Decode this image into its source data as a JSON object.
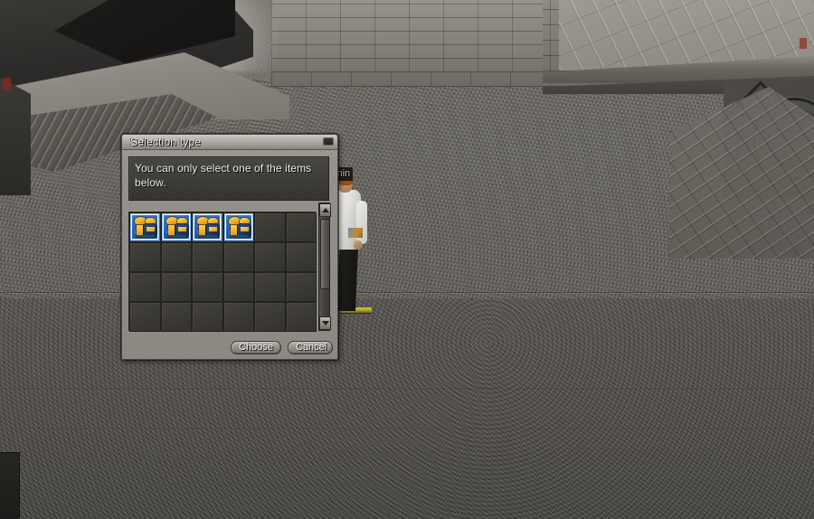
{
  "scene": {
    "character": {
      "name_label": "Admin",
      "description": "player-avatar-white-shirt"
    },
    "environment": "stone-courtyard"
  },
  "dialog": {
    "title": "Selection type",
    "close_icon": "close-icon",
    "message": "You can only select one of the items below.",
    "scrollbar": {
      "up_icon": "arrow-up-icon",
      "down_icon": "arrow-down-icon"
    },
    "grid": {
      "columns": 6,
      "rows": 4,
      "cells": [
        {
          "filled": true,
          "selected": true,
          "icon": "blue-gold-item-icon"
        },
        {
          "filled": true,
          "selected": true,
          "icon": "blue-gold-item-icon"
        },
        {
          "filled": true,
          "selected": true,
          "icon": "blue-gold-item-icon"
        },
        {
          "filled": true,
          "selected": true,
          "icon": "blue-gold-item-icon"
        },
        {
          "filled": false,
          "selected": false,
          "icon": ""
        },
        {
          "filled": false,
          "selected": false,
          "icon": ""
        },
        {
          "filled": false,
          "selected": false,
          "icon": ""
        },
        {
          "filled": false,
          "selected": false,
          "icon": ""
        },
        {
          "filled": false,
          "selected": false,
          "icon": ""
        },
        {
          "filled": false,
          "selected": false,
          "icon": ""
        },
        {
          "filled": false,
          "selected": false,
          "icon": ""
        },
        {
          "filled": false,
          "selected": false,
          "icon": ""
        },
        {
          "filled": false,
          "selected": false,
          "icon": ""
        },
        {
          "filled": false,
          "selected": false,
          "icon": ""
        },
        {
          "filled": false,
          "selected": false,
          "icon": ""
        },
        {
          "filled": false,
          "selected": false,
          "icon": ""
        },
        {
          "filled": false,
          "selected": false,
          "icon": ""
        },
        {
          "filled": false,
          "selected": false,
          "icon": ""
        },
        {
          "filled": false,
          "selected": false,
          "icon": ""
        },
        {
          "filled": false,
          "selected": false,
          "icon": ""
        },
        {
          "filled": false,
          "selected": false,
          "icon": ""
        },
        {
          "filled": false,
          "selected": false,
          "icon": ""
        },
        {
          "filled": false,
          "selected": false,
          "icon": ""
        },
        {
          "filled": false,
          "selected": false,
          "icon": ""
        }
      ]
    },
    "buttons": {
      "choose": "Choose",
      "cancel": "Cancel"
    }
  },
  "colors": {
    "dialog_face": "#98958e",
    "dialog_dark_panel": "#3c3a36",
    "item_blue": "#1f63b8",
    "item_gold": "#f0a828",
    "text_light": "#eceae6",
    "marker_yellow": "#d9c93a"
  }
}
